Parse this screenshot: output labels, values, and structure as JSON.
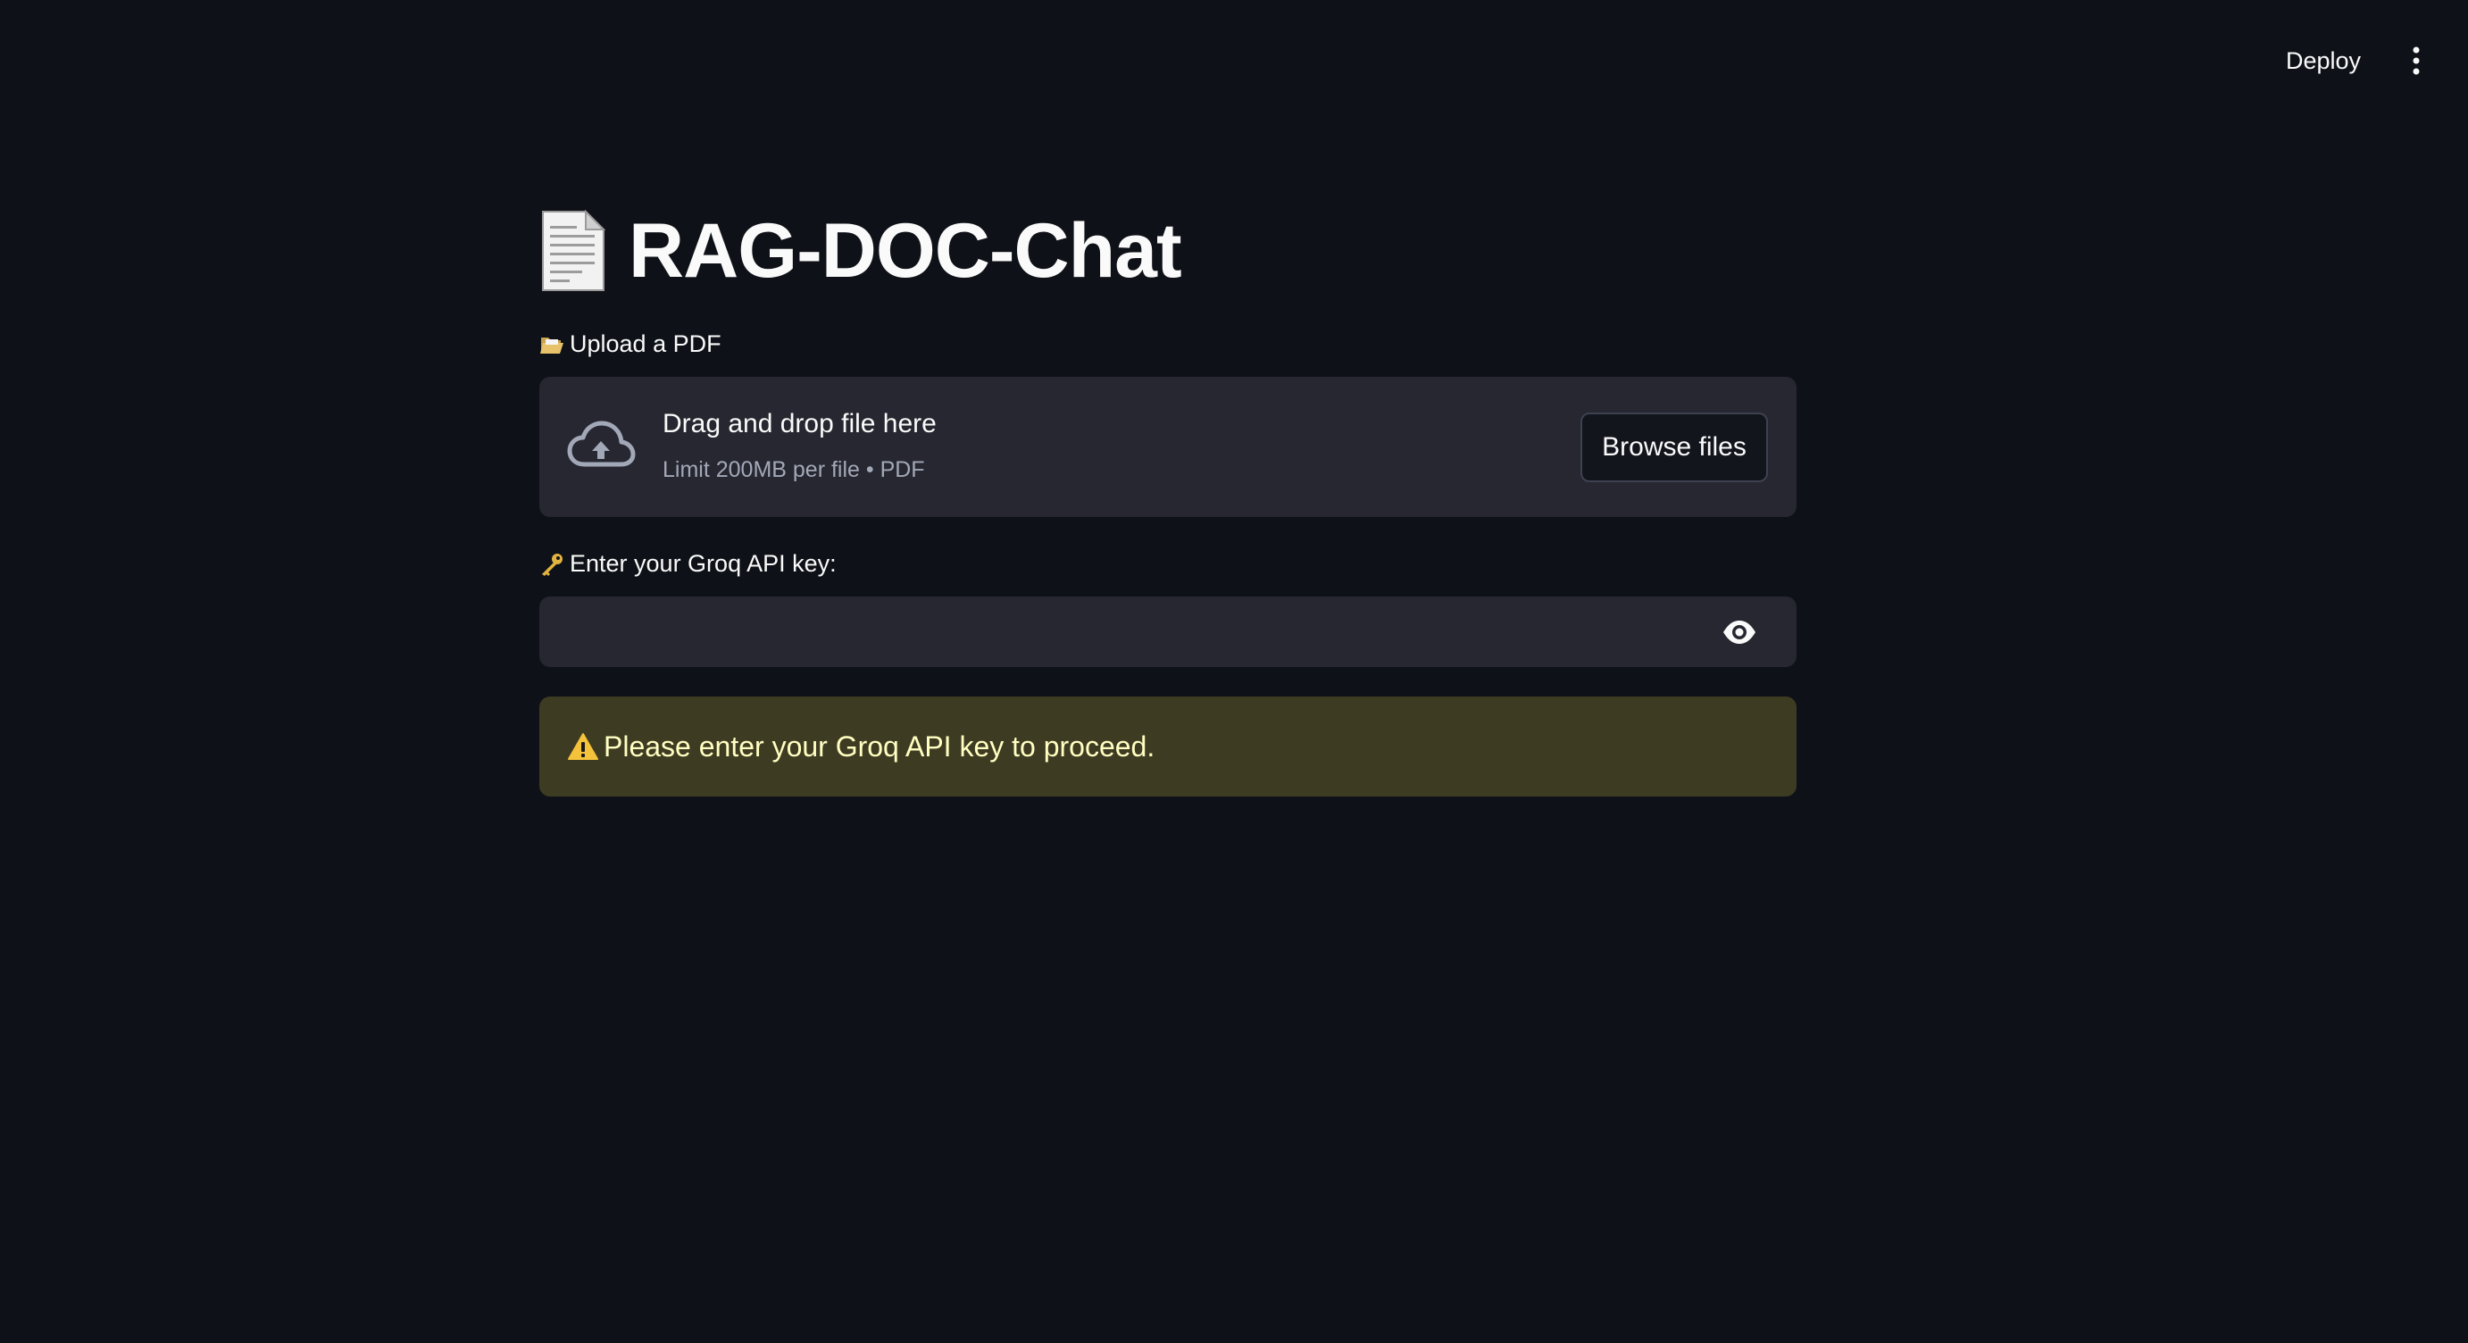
{
  "header": {
    "deploy_label": "Deploy",
    "menu_icon": "vertical-ellipsis-icon"
  },
  "main": {
    "title_icon": "page-facing-up-icon",
    "title": "RAG-DOC-Chat",
    "uploader": {
      "label_icon": "open-folder-icon",
      "label": "Upload a PDF",
      "dropzone_icon": "cloud-upload-icon",
      "drop_title": "Drag and drop file here",
      "drop_subtitle": "Limit 200MB per file • PDF",
      "browse_label": "Browse files"
    },
    "api_key": {
      "label_icon": "key-icon",
      "label": "Enter your Groq API key:",
      "value": "",
      "placeholder": "",
      "toggle_icon": "eye-icon"
    },
    "warning": {
      "icon": "warning-triangle-icon",
      "text": "Please enter your Groq API key to proceed."
    }
  },
  "colors": {
    "background": "#0e1117",
    "widget_background": "#262730",
    "warning_background": "#3e3b23",
    "warning_text": "#ffffc2",
    "muted_text": "#a3a8b8",
    "primary_text": "#fafafa"
  }
}
